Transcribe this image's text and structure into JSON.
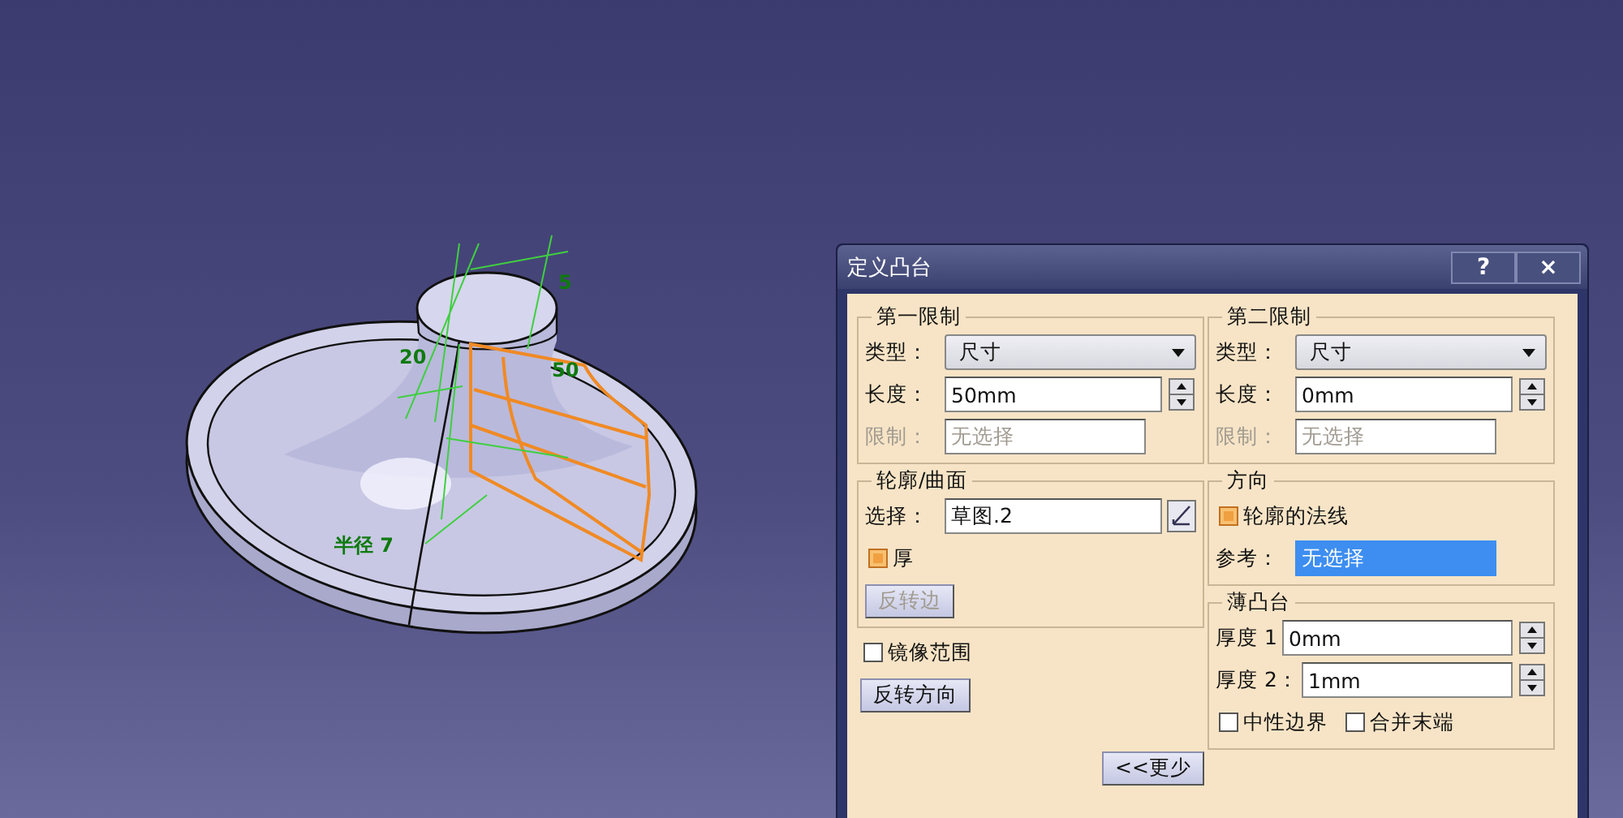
{
  "viewport": {
    "labels": [
      {
        "text": "5"
      },
      {
        "text": "20"
      },
      {
        "text": "50"
      },
      {
        "text": "半径 7"
      }
    ]
  },
  "dialog": {
    "title": "定义凸台",
    "title_buttons": [
      "?",
      "×"
    ],
    "limits": [
      {
        "title": "第一限制",
        "type_label": "类型：",
        "type_value": "尺寸",
        "length_label": "长度：",
        "length_value": "50mm",
        "limit_label": "限制：",
        "limit_value": "无选择",
        "limit_disabled": true
      },
      {
        "title": "第二限制",
        "type_label": "类型：",
        "type_value": "尺寸",
        "length_label": "长度：",
        "length_value": "0mm",
        "limit_label": "限制：",
        "limit_value": "无选择",
        "limit_disabled": true
      }
    ],
    "profile": {
      "title": "轮廓/曲面",
      "select_label": "选择：",
      "select_value": "草图.2",
      "thick": {
        "label": "厚",
        "checked": true
      },
      "reverse_side": {
        "label": "反转边",
        "disabled": true
      }
    },
    "mirrored_extent": {
      "label": "镜像范围",
      "checked": false
    },
    "reverse_direction": {
      "label": "反转方向",
      "disabled": false
    },
    "less_button": {
      "label": "<<更少"
    },
    "direction": {
      "title": "方向",
      "normal": {
        "label": "轮廓的法线",
        "checked": true
      },
      "reference_label": "参考：",
      "reference_value": "无选择",
      "reference_selected": true
    },
    "thin_pad": {
      "title": "薄凸台",
      "thickness1_label": "厚度 1",
      "thickness1_value": "0mm",
      "thickness2_label": "厚度 2：",
      "thickness2_value": "1mm",
      "options": [
        {
          "label": "中性边界",
          "checked": false
        },
        {
          "label": "合并末端",
          "checked": false
        }
      ]
    }
  }
}
